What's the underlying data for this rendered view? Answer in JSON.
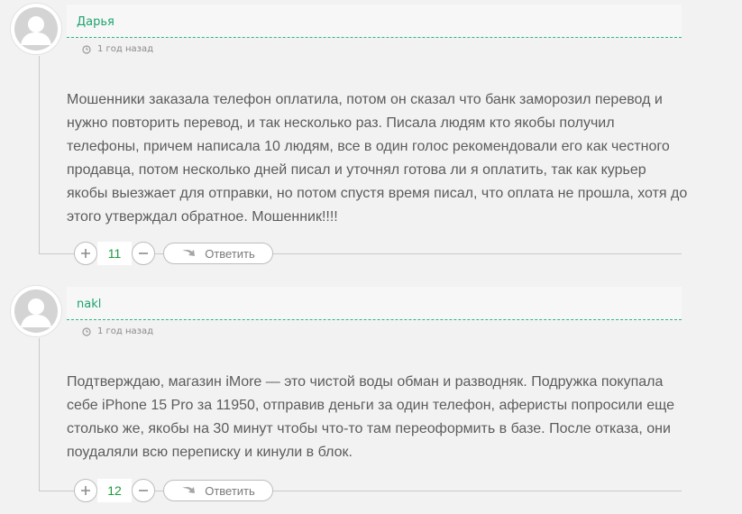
{
  "comments": [
    {
      "author": "Дарья",
      "time": "1 год назад",
      "text": "Мошенники заказала телефон оплатила, потом он сказал что банк заморозил перевод и нужно повторить перевод, и так несколько раз. Писала людям кто якобы получил телефоны, причем написала 10 людям, все в один голос рекомендовали его как честного продавца, потом несколько дней писал и уточнял готова ли я оплатить, так как курьер якобы выезжает для отправки, но потом спустя время писал, что оплата не прошла, хотя до этого утверждал обратное. Мошенник!!!!",
      "votes": "11",
      "reply_label": "Ответить"
    },
    {
      "author": "nakl",
      "time": "1 год назад",
      "text": "Подтверждаю, магазин iMore — это чистой воды обман и разводняк. Подружка покупала себе iPhone 15 Pro за 11950, отправив деньги за один телефон, аферисты попросили еще столько же, якобы на 30 минут чтобы что-то там переоформить в базе. После отказа, они поудаляли всю переписку и кинули в блок.",
      "votes": "12",
      "reply_label": "Ответить"
    }
  ],
  "icons": {
    "avatar": "default-user-avatar",
    "time": "clock-icon",
    "upvote": "plus-icon",
    "downvote": "minus-icon",
    "reply": "reply-arrow-icon"
  },
  "colors": {
    "author": "#1fa36f",
    "votes": "#1d9b3d",
    "dashed_line": "#2db77f"
  }
}
